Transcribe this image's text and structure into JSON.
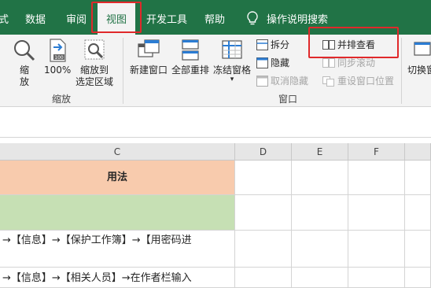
{
  "tabs": {
    "partial_left": "式",
    "data": "数据",
    "review": "审阅",
    "view": "视图",
    "developer": "开发工具",
    "help": "帮助",
    "search": "操作说明搜索"
  },
  "ribbon": {
    "zoom_group": {
      "zoom_label_1": "缩",
      "zoom_label_2": "放",
      "hundred_label": "100%",
      "zoom_sel_label_1": "缩放到",
      "zoom_sel_label_2": "选定区域",
      "group_name": "缩放"
    },
    "window_group": {
      "new_window": "新建窗口",
      "arrange_all": "全部重排",
      "freeze_panes": "冻结窗格",
      "split": "拆分",
      "hide": "隐藏",
      "unhide": "取消隐藏",
      "side_by_side": "并排查看",
      "sync_scroll": "同步滚动",
      "reset_position": "重设窗口位置",
      "group_name": "窗口"
    },
    "switch_partial": "切换窗"
  },
  "grid": {
    "columns": [
      "C",
      "D",
      "E",
      "F"
    ],
    "header_cell": "用法",
    "row3_text": "→【信息】→【保护工作簿】→【用密码进",
    "row4_text": "→【信息】→【相关人员】→在作者栏输入"
  },
  "colors": {
    "excel_green": "#217346",
    "highlight_red": "#e0292b",
    "header_orange": "#f8cbad",
    "row_green": "#c6e0b4"
  },
  "icons": [
    "lightbulb-icon",
    "zoom-icon",
    "hundred-percent-icon",
    "zoom-selection-icon",
    "new-window-icon",
    "arrange-all-icon",
    "freeze-panes-icon",
    "split-icon",
    "hide-icon",
    "unhide-icon",
    "side-by-side-icon",
    "sync-scroll-icon",
    "reset-window-icon",
    "switch-windows-icon"
  ]
}
